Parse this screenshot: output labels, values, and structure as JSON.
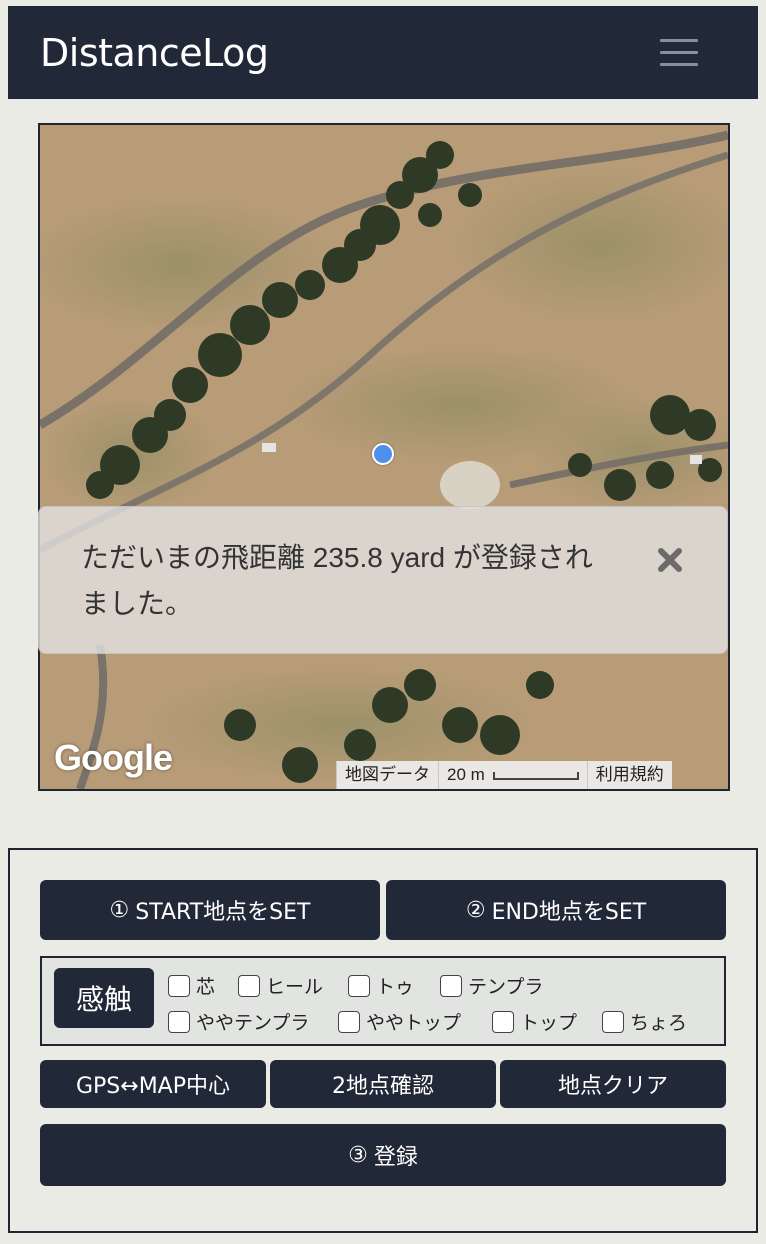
{
  "navbar": {
    "brand": "DistanceLog",
    "menu_icon": "hamburger-menu-icon"
  },
  "map": {
    "google_logo": "Google",
    "map_data_label": "地図データ",
    "scale_label": "20 m",
    "terms_label": "利用規約"
  },
  "toast": {
    "message": "ただいまの飛距離 235.8 yard が登録されました。",
    "close_icon": "close-icon"
  },
  "controls": {
    "start_button": {
      "icon": "①",
      "label": "START地点をSET"
    },
    "end_button": {
      "icon": "②",
      "label": "END地点をSET"
    },
    "touch_label": "感触",
    "touch_options": [
      "芯",
      "ヒール",
      "トゥ",
      "テンプラ",
      "ややテンプラ",
      "ややトップ",
      "トップ",
      "ちょろ"
    ],
    "gps_button": "GPS↔MAP中心",
    "confirm_button": "2地点確認",
    "clear_button": "地点クリア",
    "register_button": {
      "icon": "③",
      "label": "登録"
    }
  },
  "colors": {
    "navbar_bg": "#212837",
    "button_bg": "#212837",
    "location_dot": "#4d8fea",
    "page_bg": "#ebebe6"
  }
}
